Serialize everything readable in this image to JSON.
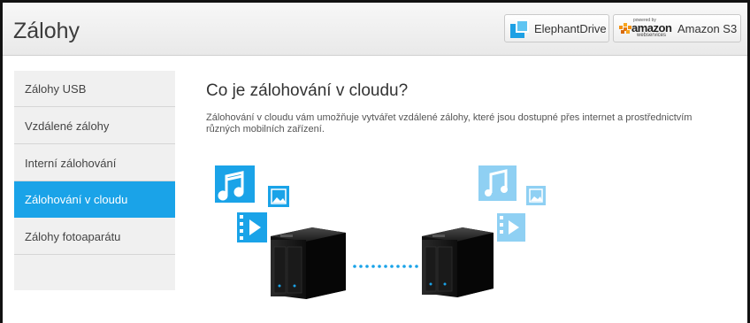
{
  "header": {
    "title": "Zálohy",
    "providers": [
      {
        "label": "ElephantDrive",
        "icon": "elephantdrive-logo-icon"
      },
      {
        "label": "Amazon S3",
        "icon": "amazon-webservices-logo-icon",
        "logo_text": "amazon",
        "logo_subtext": "webservices",
        "logo_powered": "powered by"
      }
    ]
  },
  "sidebar": {
    "items": [
      {
        "label": "Zálohy USB",
        "active": false
      },
      {
        "label": "Vzdálené zálohy",
        "active": false
      },
      {
        "label": "Interní zálohování",
        "active": false
      },
      {
        "label": "Zálohování v cloudu",
        "active": true
      },
      {
        "label": "Zálohy fotoaparátu",
        "active": false
      }
    ]
  },
  "main": {
    "title": "Co je zálohování v cloudu?",
    "description": "Zálohování v cloudu vám umožňuje vytvářet vzdálené zálohy, které jsou dostupné přes internet a prostřednictvím různých mobilních zařízení."
  },
  "colors": {
    "accent": "#1aa3e8",
    "accent_light": "#8fd0f3"
  }
}
